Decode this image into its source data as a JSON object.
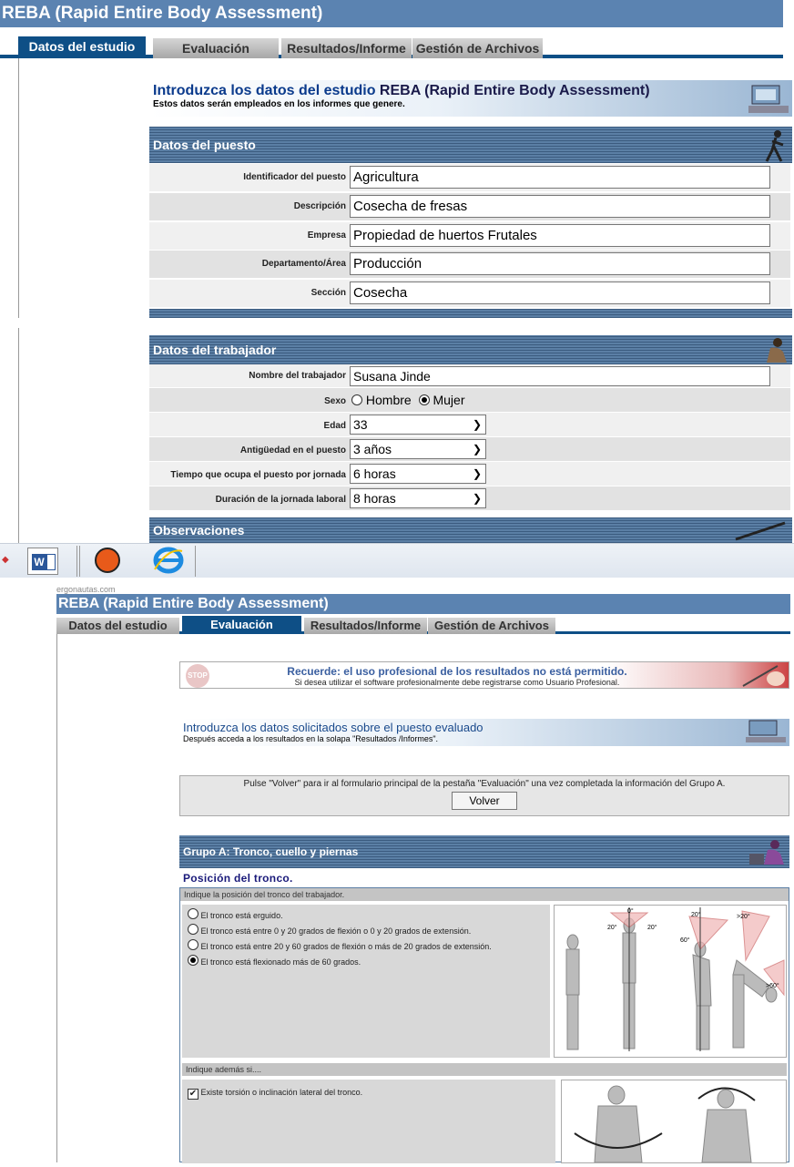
{
  "app_title": "REBA (Rapid Entire Body Assessment)",
  "tabs": [
    "Datos del estudio",
    "Evaluación",
    "Resultados/Informe",
    "Gestión de Archivos"
  ],
  "intro1": {
    "title_colored": "Introduzca los datos del estudio",
    "title_bold": "REBA (Rapid Entire Body Assessment)",
    "subtitle": "Estos datos serán empleados en los informes que genere."
  },
  "puesto": {
    "heading": "Datos del puesto",
    "rows": [
      {
        "label": "Identificador del puesto",
        "value": "Agricultura"
      },
      {
        "label": "Descripción",
        "value": "Cosecha de fresas"
      },
      {
        "label": "Empresa",
        "value": "Propiedad de huertos Frutales"
      },
      {
        "label": "Departamento/Área",
        "value": "Producción"
      },
      {
        "label": "Sección",
        "value": "Cosecha"
      }
    ]
  },
  "trabajador": {
    "heading": "Datos del trabajador",
    "nombre_label": "Nombre del trabajador",
    "nombre_value": "Susana Jinde",
    "sexo_label": "Sexo",
    "sexo_options": [
      "Hombre",
      "Mujer"
    ],
    "sexo_selected": "Mujer",
    "selects": [
      {
        "label": "Edad",
        "value": "33"
      },
      {
        "label": "Antigüedad en el puesto",
        "value": "3 años"
      },
      {
        "label": "Tiempo que ocupa el puesto por jornada",
        "value": "6 horas"
      },
      {
        "label": "Duración de la jornada laboral",
        "value": "8 horas"
      }
    ]
  },
  "observaciones_heading": "Observaciones",
  "taskbar": {
    "icons": [
      "word-icon",
      "glove-icon",
      "ie-icon"
    ]
  },
  "site_tag": "ergonautas.com",
  "second": {
    "app_title": "REBA (Rapid Entire Body Assessment)",
    "tabs": [
      "Datos del estudio",
      "Evaluación",
      "Resultados/Informe",
      "Gestión de Archivos"
    ],
    "notice_title": "Recuerde: el uso profesional de los resultados no está permitido.",
    "notice_sub": "Si desea utilizar el software profesionalmente debe registrarse como Usuario Profesional.",
    "stop_text": "STOP",
    "intro_title": "Introduzca los datos solicitados sobre el puesto evaluado",
    "intro_sub": "Después acceda a los resultados en la solapa \"Resultados /Informes\".",
    "volver_text": "Pulse \"Volver\" para ir al formulario principal de la pestaña \"Evaluación\" una vez completada la información del Grupo A.",
    "volver_button": "Volver",
    "grupo_heading": "Grupo A: Tronco, cuello y piernas",
    "posicion_heading": "Posición del tronco.",
    "posicion_sub": "Indique la posición del tronco del trabajador.",
    "options": [
      "El tronco está erguido.",
      "El tronco está entre 0 y 20 grados de flexión o 0 y 20 grados de extensión.",
      "El tronco está entre 20 y 60 grados de flexión o más de 20 grados de extensión.",
      "El tronco está flexionado más de 60 grados."
    ],
    "selected_option": 3,
    "fig_labels": [
      "0°",
      "20°",
      "20°",
      "20°",
      "60°",
      ">20°",
      ">60°"
    ],
    "ademas_sub": "Indique además si....",
    "torsion_label": "Existe torsión o inclinación lateral del tronco.",
    "torsion_checked": true
  }
}
